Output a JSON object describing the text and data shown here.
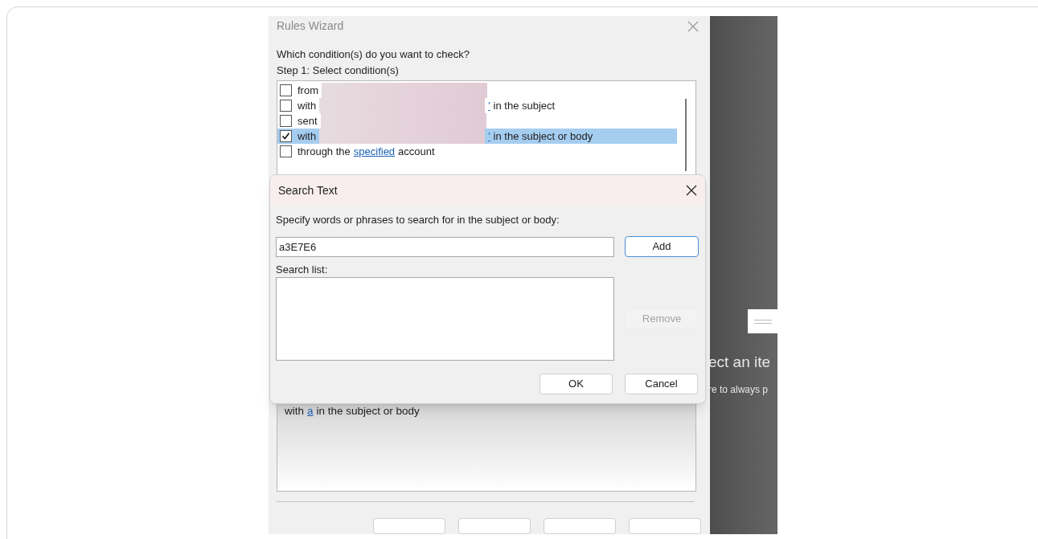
{
  "wizard": {
    "title": "Rules Wizard",
    "question": "Which condition(s) do you want to check?",
    "step": "Step 1: Select condition(s)",
    "conditions": [
      {
        "checked": false,
        "selected": false,
        "parts": [
          {
            "kind": "text",
            "text": "from"
          },
          {
            "kind": "redacted"
          }
        ]
      },
      {
        "checked": false,
        "selected": false,
        "parts": [
          {
            "kind": "text",
            "text": "with"
          },
          {
            "kind": "redacted"
          },
          {
            "kind": "link",
            "text": "'"
          },
          {
            "kind": "text",
            "text": "in the subject"
          }
        ]
      },
      {
        "checked": false,
        "selected": false,
        "parts": [
          {
            "kind": "text",
            "text": "sent"
          },
          {
            "kind": "redacted"
          }
        ]
      },
      {
        "checked": true,
        "selected": true,
        "parts": [
          {
            "kind": "text",
            "text": "with"
          },
          {
            "kind": "redacted"
          },
          {
            "kind": "link",
            "text": "'"
          },
          {
            "kind": "text",
            "text": "in the subject or body"
          }
        ]
      },
      {
        "checked": false,
        "selected": false,
        "parts": [
          {
            "kind": "text",
            "text": "through the"
          },
          {
            "kind": "link",
            "text": "specified"
          },
          {
            "kind": "text",
            "text": "account"
          }
        ]
      }
    ],
    "description": [
      {
        "kind": "text",
        "text": "with"
      },
      {
        "kind": "link",
        "text": "a"
      },
      {
        "kind": "text",
        "text": "in the subject or body"
      }
    ]
  },
  "search_dialog": {
    "title": "Search Text",
    "prompt": "Specify words or phrases to search for in the subject or body:",
    "value": "a3E7E6",
    "add": "Add",
    "list_label": "Search list:",
    "remove": {
      "label": "Remove",
      "disabled": true
    },
    "ok": "OK",
    "cancel": "Cancel"
  },
  "background_panel": {
    "heading": "ect an ite",
    "hint": "re to always p"
  }
}
